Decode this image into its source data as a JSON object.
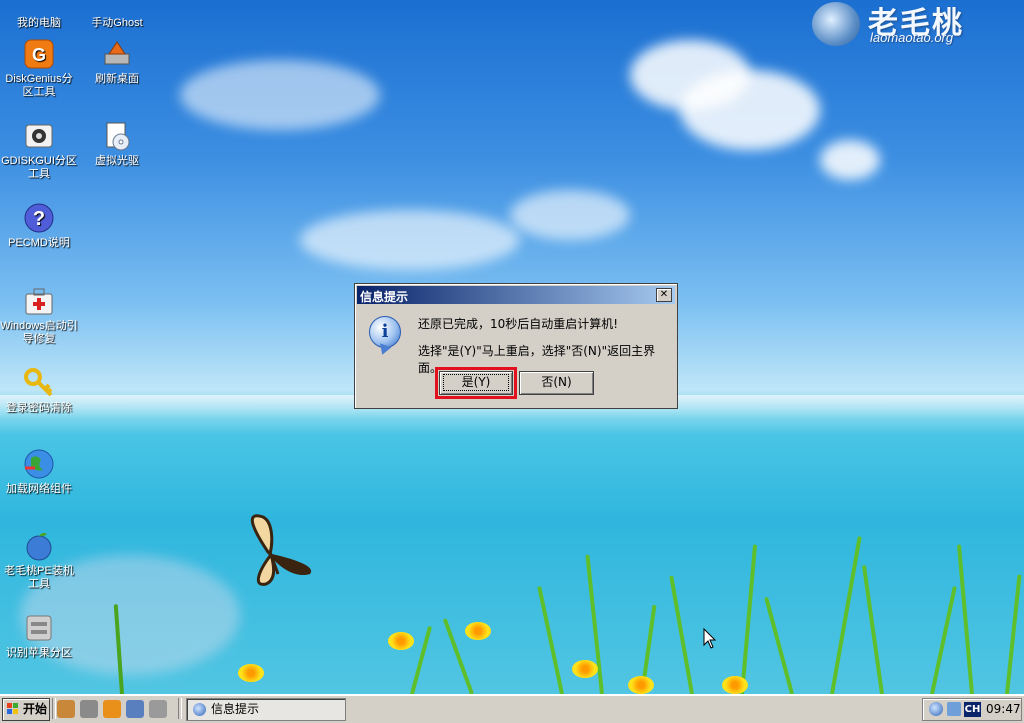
{
  "brand": {
    "title": "老毛桃",
    "url": "laomaotao.org"
  },
  "desktop": {
    "icons": [
      {
        "label": "我的电脑",
        "icon": "computer-icon"
      },
      {
        "label": "手动Ghost",
        "icon": "ghost-icon"
      },
      {
        "label": "DiskGenius分区工具",
        "icon": "diskgenius-icon"
      },
      {
        "label": "刷新桌面",
        "icon": "refresh-desktop-icon"
      },
      {
        "label": "GDISKGUI分区工具",
        "icon": "gdiskgui-icon"
      },
      {
        "label": "虚拟光驱",
        "icon": "virtual-drive-icon"
      },
      {
        "label": "PECMD说明",
        "icon": "help-icon"
      },
      {
        "label": "Windows启动引导修复",
        "icon": "boot-repair-icon"
      },
      {
        "label": "登录密码清除",
        "icon": "key-icon"
      },
      {
        "label": "加载网络组件",
        "icon": "network-globe-icon"
      },
      {
        "label": "老毛桃PE装机工具",
        "icon": "peach-installer-icon"
      },
      {
        "label": "识别苹果分区",
        "icon": "apple-partition-icon"
      }
    ]
  },
  "dialog": {
    "title": "信息提示",
    "close_label": "✕",
    "icon": "info-icon",
    "message_line1": "还原已完成，10秒后自动重启计算机!",
    "message_line2": "选择\"是(Y)\"马上重启，选择\"否(N)\"返回主界面。",
    "yes_label": "是(Y)",
    "no_label": "否(N)"
  },
  "taskbar": {
    "start_label": "开始",
    "quick_launch": [
      "app-icon-1",
      "app-icon-2",
      "app-icon-3",
      "app-icon-4",
      "app-icon-5"
    ],
    "task_label": "信息提示",
    "tray_lang": "CH",
    "clock": "09:47"
  },
  "colors": {
    "dialog_bg": "#d4d0c8",
    "titlebar_start": "#0a246a",
    "titlebar_end": "#a6caf0",
    "highlight_border": "#e3101d"
  }
}
